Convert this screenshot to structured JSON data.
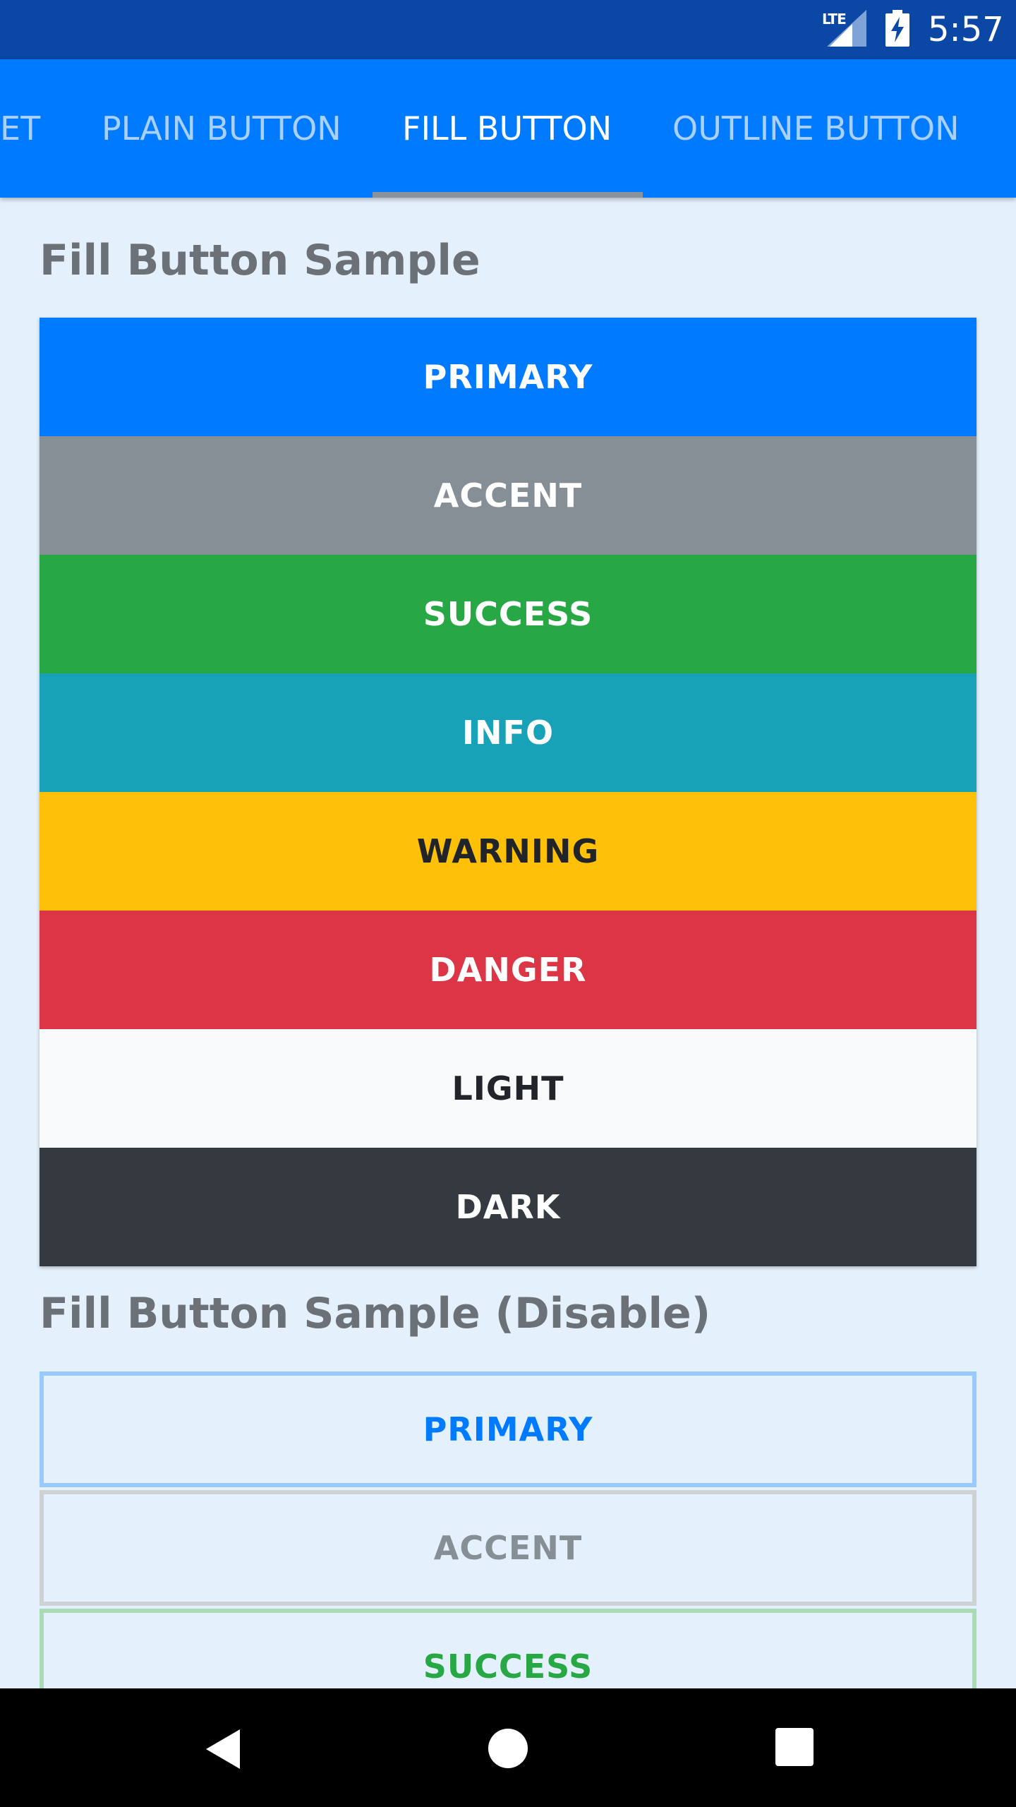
{
  "status_bar": {
    "network": "LTE",
    "time": "5:57",
    "icons": [
      "signal-icon",
      "battery-charging-icon"
    ]
  },
  "tabs": [
    {
      "label": "ET",
      "active": false
    },
    {
      "label": "PLAIN BUTTON",
      "active": false
    },
    {
      "label": "FILL BUTTON",
      "active": true
    },
    {
      "label": "OUTLINE BUTTON",
      "active": false
    }
  ],
  "fill_section": {
    "title": "Fill Button Sample",
    "buttons": [
      {
        "label": "PRIMARY",
        "bg": "#007bff",
        "fg": "#ffffff"
      },
      {
        "label": "ACCENT",
        "bg": "#868e96",
        "fg": "#ffffff"
      },
      {
        "label": "SUCCESS",
        "bg": "#28a745",
        "fg": "#ffffff"
      },
      {
        "label": "INFO",
        "bg": "#17a2b8",
        "fg": "#ffffff"
      },
      {
        "label": "WARNING",
        "bg": "#ffc107",
        "fg": "#212529"
      },
      {
        "label": "DANGER",
        "bg": "#dc3545",
        "fg": "#ffffff"
      },
      {
        "label": "LIGHT",
        "bg": "#f8f9fa",
        "fg": "#212529"
      },
      {
        "label": "DARK",
        "bg": "#343a40",
        "fg": "#ffffff"
      }
    ]
  },
  "disabled_section": {
    "title": "Fill Button Sample (Disable)",
    "buttons": [
      {
        "label": "PRIMARY",
        "border": "#99caff",
        "fg": "#007bff"
      },
      {
        "label": "ACCENT",
        "border": "#cfd2d5",
        "fg": "#868e96"
      },
      {
        "label": "SUCCESS",
        "border": "#a9dcb5",
        "fg": "#28a745"
      }
    ]
  },
  "nav_bar": {
    "icons": [
      "back-icon",
      "home-icon",
      "recents-icon"
    ]
  },
  "colors": {
    "status_bar": "#0b47a5",
    "app_bar": "#007bff",
    "background": "#e4f0fb",
    "title_text": "#6b7177"
  }
}
